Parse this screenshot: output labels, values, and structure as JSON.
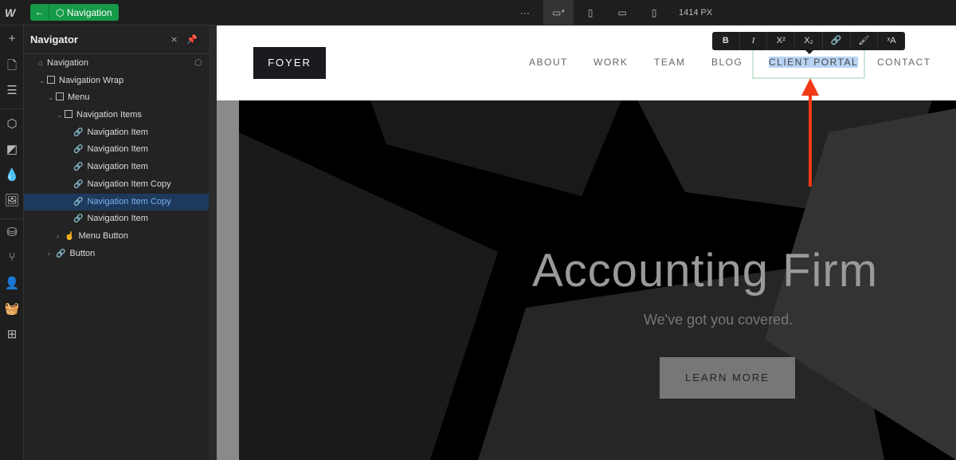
{
  "topbar": {
    "logo": "W",
    "back": "←",
    "component": "Navigation",
    "more": "···",
    "width_label": "1414 PX"
  },
  "navigator": {
    "title": "Navigator",
    "items": [
      {
        "label": "Navigation",
        "type": "home",
        "depth": 0
      },
      {
        "label": "Navigation Wrap",
        "type": "box",
        "depth": 1,
        "expanded": true
      },
      {
        "label": "Menu",
        "type": "box",
        "depth": 2,
        "expanded": true
      },
      {
        "label": "Navigation Items",
        "type": "box",
        "depth": 3,
        "expanded": true
      },
      {
        "label": "Navigation Item",
        "type": "link",
        "depth": 4
      },
      {
        "label": "Navigation Item",
        "type": "link",
        "depth": 4
      },
      {
        "label": "Navigation Item",
        "type": "link",
        "depth": 4
      },
      {
        "label": "Navigation Item Copy",
        "type": "link",
        "depth": 4
      },
      {
        "label": "Navigation Item Copy",
        "type": "link",
        "depth": 4,
        "selected": true
      },
      {
        "label": "Navigation Item",
        "type": "link",
        "depth": 4
      },
      {
        "label": "Menu Button",
        "type": "hand",
        "depth": 3,
        "collapsed": true
      },
      {
        "label": "Button",
        "type": "link",
        "depth": 2,
        "collapsed": true
      }
    ]
  },
  "site": {
    "brand": "FOYER",
    "nav": [
      "ABOUT",
      "WORK",
      "TEAM",
      "BLOG",
      "CLIENT PORTAL",
      "CONTACT"
    ],
    "hero_title": "Accounting Firm",
    "hero_sub": "We've got you covered.",
    "cta": "LEARN MORE"
  },
  "format_toolbar": [
    "B",
    "I",
    "X²",
    "X₂",
    "🔗",
    "🖌",
    "ˣA"
  ],
  "colors": {
    "accent": "#159a47",
    "selection": "#1d3a5c",
    "arrow": "#f03a17"
  }
}
